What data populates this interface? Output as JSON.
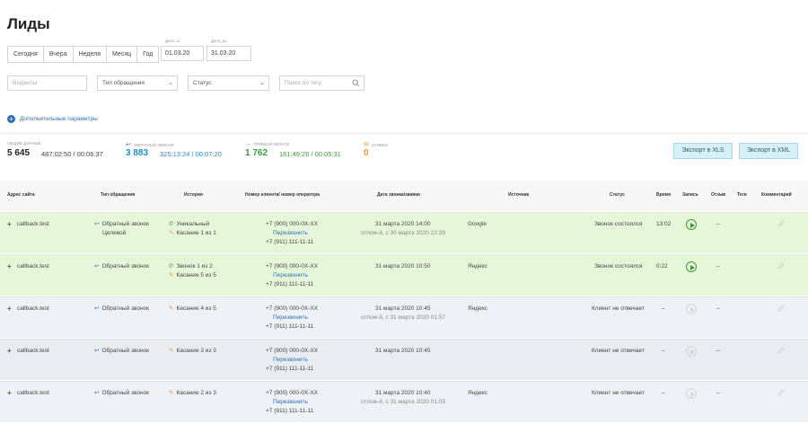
{
  "page": {
    "title": "Лиды"
  },
  "period_buttons": [
    "Сегодня",
    "Вчера",
    "Неделя",
    "Месяц",
    "Год"
  ],
  "date_from": {
    "label": "Дата, от",
    "value": "01.03.20"
  },
  "date_to": {
    "label": "Дата, до",
    "value": "31.03.20"
  },
  "filters": {
    "widgets_placeholder": "Виджеты",
    "type_select": "Тип обращения",
    "status_select": "Статус",
    "tag_search_placeholder": "Поиск по тегу"
  },
  "more_params": "Дополнительные параметры",
  "stats": {
    "total": {
      "label": "Общие данные",
      "count": "5 645",
      "times": "487:02:50 / 00:06:37"
    },
    "callback": {
      "label": "Обратный звонок",
      "count": "3 883",
      "times": "325:13:24 / 00:07:20"
    },
    "direct": {
      "label": "Прямой звонок",
      "count": "1 762",
      "times": "161:49:26 / 00:05:31"
    },
    "requests": {
      "label": "Заявки",
      "count": "0"
    }
  },
  "export": {
    "xls": "Экспорт в XLS",
    "xml": "Экспорт в XML"
  },
  "colors": {
    "accent_blue": "#2e6fb2",
    "callback_blue": "#2a8ab8",
    "direct_green": "#3a9a3a",
    "requests_orange": "#e69a2e",
    "row_green": "#e6f7d9",
    "row_gray": "#eef1f5"
  },
  "table": {
    "headers": [
      "Адрес сайта",
      "Тип обращения",
      "История",
      "Номер клиента/ номер оператора",
      "Дата звонка/заявки",
      "Источник",
      "Статус",
      "Время",
      "Запись",
      "Отзыв",
      "Теги",
      "Комментарий"
    ],
    "rows": [
      {
        "site": "callback.test",
        "type": "Обратный звонок",
        "type_extra": "Целевой",
        "history1_icon": "phone",
        "history1": "Уникальный",
        "history2": "Касание 1 из 1",
        "client": "+7 (900) 000-0X-XX",
        "recall": "Перезвонить",
        "operator": "+7 (911) 111-11-11",
        "date": "31 марта 2020 14:00",
        "date_extra": "отлож-й, с 30 марта 2020 22:39",
        "source": "Google",
        "status": "Звонок состоялся",
        "time": "13:02",
        "record": true,
        "review": "–"
      },
      {
        "site": "callback.test",
        "type": "Обратный звонок",
        "type_extra": "",
        "history1_icon": "phone",
        "history1": "Звонок 1 из 2",
        "history2": "Касание 5 из 5",
        "client": "+7 (900) 000-0X-XX",
        "recall": "Перезвонить",
        "operator": "+7 (911) 111-11-11",
        "date": "31 марта 2020 10:50",
        "date_extra": "",
        "source": "Яндекс",
        "status": "Звонок состоялся",
        "time": "0:22",
        "record": true,
        "review": "–"
      },
      {
        "site": "callback.test",
        "type": "Обратный звонок",
        "type_extra": "",
        "history1_icon": "touch",
        "history1": "Касание 4 из 5",
        "history2": "",
        "client": "+7 (900) 000-0X-XX",
        "recall": "Перезвонить",
        "operator": "+7 (911) 111-11-11",
        "date": "31 марта 2020 10:45",
        "date_extra": "отлож-й, с 31 марта 2020 01:57",
        "source": "Яндекс",
        "status": "Клиент не отвечает",
        "time": "–",
        "record": false,
        "review": "–"
      },
      {
        "site": "callback.test",
        "type": "Обратный звонок",
        "type_extra": "",
        "history1_icon": "touch",
        "history1": "Касание 3 из 3",
        "history2": "",
        "client": "+7 (900) 000-0X-XX",
        "recall": "Перезвонить",
        "operator": "+7 (911) 111-11-11",
        "date": "31 марта 2020 10:45",
        "date_extra": "",
        "source": "",
        "status": "Клиент не отвечает",
        "time": "–",
        "record": false,
        "review": "–"
      },
      {
        "site": "callback.test",
        "type": "Обратный звонок",
        "type_extra": "",
        "history1_icon": "touch",
        "history1": "Касание 2 из 3",
        "history2": "",
        "client": "+7 (900) 000-0X-XX",
        "recall": "Перезвонить",
        "operator": "+7 (911) 111-11-11",
        "date": "31 марта 2020 10:40",
        "date_extra": "отлож-й, с 31 марта 2020 01:05",
        "source": "Яндекс",
        "status": "Клиент не отвечает",
        "time": "–",
        "record": false,
        "review": "–"
      }
    ]
  }
}
